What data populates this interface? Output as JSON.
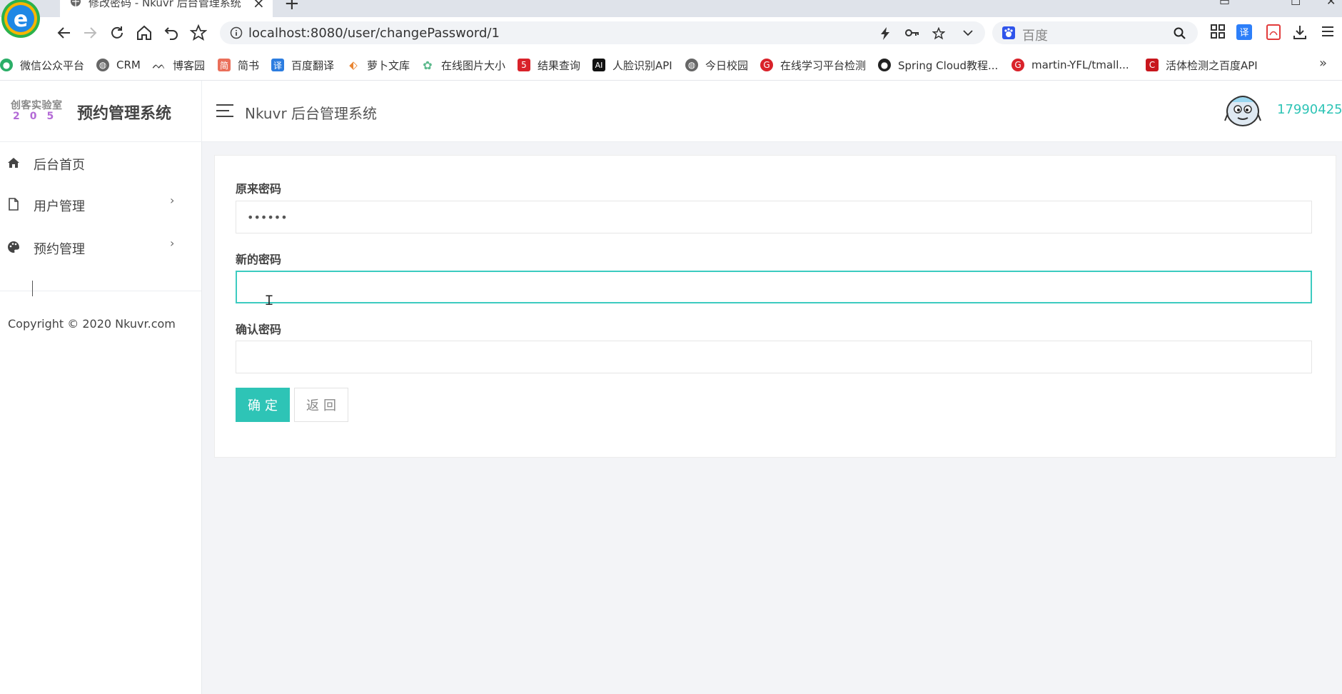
{
  "browser": {
    "tab_title": "修改密码 - Nkuvr 后台管理系统",
    "url": "localhost:8080/user/changePassword/1",
    "search_placeholder": "百度",
    "bookmarks": [
      {
        "label": "微信公众平台",
        "icon": "wechat-icon",
        "color": "#2aae67"
      },
      {
        "label": "CRM",
        "icon": "globe-icon",
        "color": "#666666"
      },
      {
        "label": "博客园",
        "icon": "cnblogs-icon",
        "color": "#444444"
      },
      {
        "label": "简书",
        "icon": "jianshu-icon",
        "color": "#ea6f5a"
      },
      {
        "label": "百度翻译",
        "icon": "baidu-translate-icon",
        "color": "#2c7de0"
      },
      {
        "label": "萝卜文库",
        "icon": "carrot-icon",
        "color": "#e98532"
      },
      {
        "label": "在线图片大小",
        "icon": "flower-icon",
        "color": "#5bb98c"
      },
      {
        "label": "结果查询",
        "icon": "five-icon",
        "color": "#d9222a"
      },
      {
        "label": "人脸识别API",
        "icon": "ai-icon",
        "color": "#111111"
      },
      {
        "label": "今日校园",
        "icon": "globe-icon",
        "color": "#666666"
      },
      {
        "label": "在线学习平台检测",
        "icon": "g-icon",
        "color": "#d9222a"
      },
      {
        "label": "Spring Cloud教程...",
        "icon": "github-icon",
        "color": "#222222"
      },
      {
        "label": "martin-YFL/tmall...",
        "icon": "g-icon",
        "color": "#d9222a"
      },
      {
        "label": "活体检测之百度API",
        "icon": "c-icon",
        "color": "#c8161d"
      }
    ]
  },
  "header": {
    "logo_top": "创客实验室",
    "logo_bottom": "205",
    "brand": "预约管理系统",
    "title": "Nkuvr 后台管理系统",
    "username": "17990425"
  },
  "sidebar": {
    "items": [
      {
        "label": "后台首页",
        "icon": "home-icon"
      },
      {
        "label": "用户管理",
        "icon": "file-icon",
        "chevron": "›"
      },
      {
        "label": "预约管理",
        "icon": "palette-icon",
        "chevron": "›"
      }
    ],
    "copyright": "Copyright © 2020 Nkuvr.com"
  },
  "form": {
    "old_password_label": "原来密码",
    "old_password_value": "••••••",
    "new_password_label": "新的密码",
    "new_password_value": "",
    "confirm_password_label": "确认密码",
    "confirm_password_value": "",
    "confirm_button": "确定",
    "back_button": "返回"
  },
  "colors": {
    "accent": "#2ec4b6",
    "focus_border": "#3ccbc0"
  }
}
